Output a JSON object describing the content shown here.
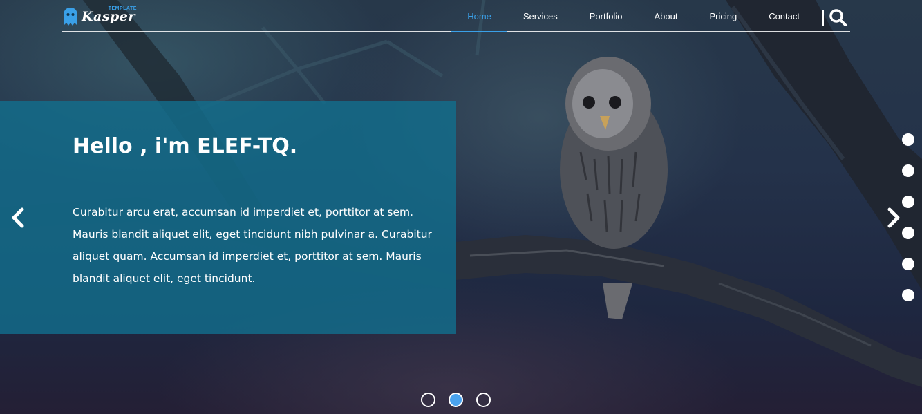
{
  "brand": {
    "name": "Kasper",
    "tag": "TEMPLATE",
    "accent": "#3aa0e8"
  },
  "nav": {
    "items": [
      "Home",
      "Services",
      "Portfolio",
      "About",
      "Pricing",
      "Contact"
    ],
    "active": "Home"
  },
  "icons": {
    "logo": "ghost-icon",
    "search": "search-icon",
    "prev": "chevron-left-icon",
    "next": "chevron-right-icon"
  },
  "hero": {
    "title": "Hello , i'm ELEF-TQ.",
    "body": "Curabitur arcu erat, accumsan id imperdiet et, porttitor at sem. Mauris blandit aliquet elit, eget tincidunt nibh pulvinar a. Curabitur aliquet quam. Accumsan id imperdiet et, porttitor at sem. Mauris blandit aliquet elit, eget tincidunt.",
    "panel_color": "#126e8c"
  },
  "side_dots": {
    "count": 6
  },
  "slider": {
    "count": 3,
    "active_index": 2
  }
}
